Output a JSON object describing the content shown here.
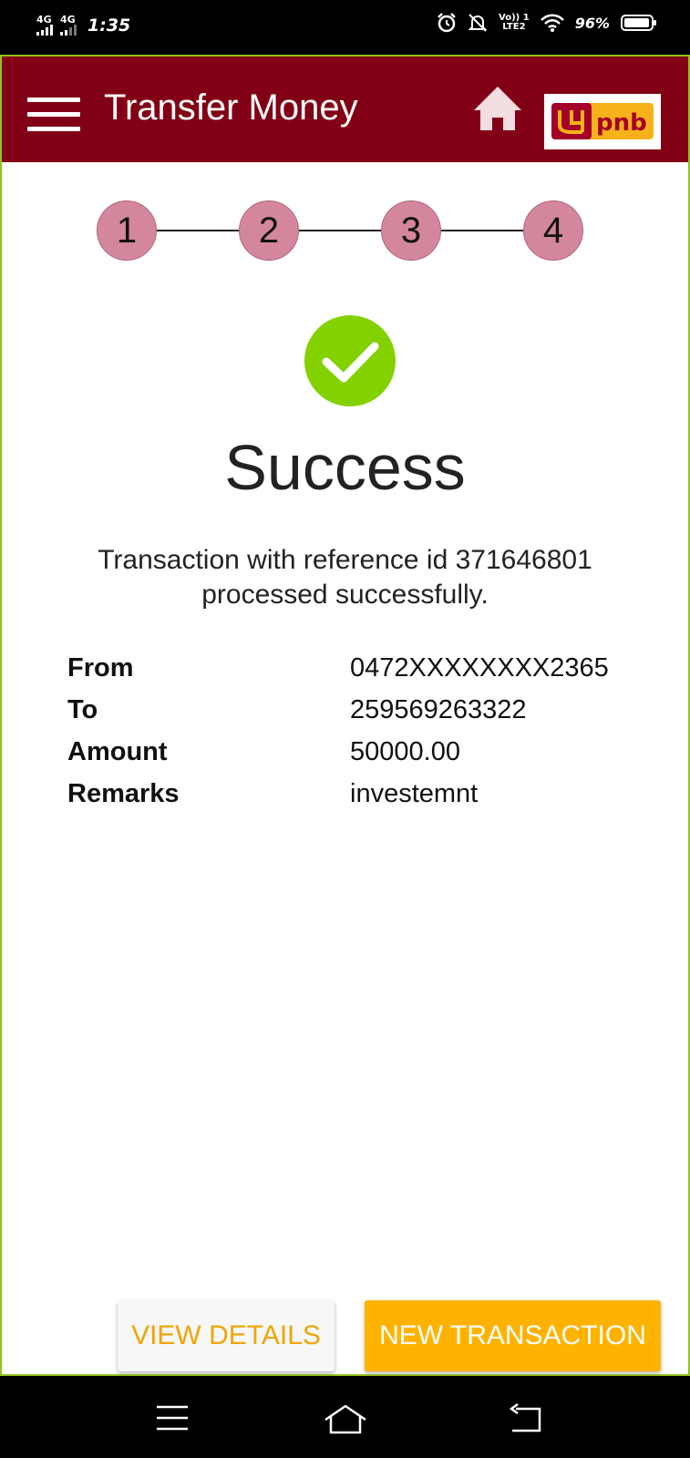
{
  "status_bar": {
    "sim1_label": "4G",
    "sim2_label": "4G",
    "time": "1:35",
    "volte_line1": "Vo)) 1",
    "volte_line2": "LTE2",
    "battery_percent": "96%",
    "battery_level": 0.96,
    "icons": [
      "alarm-icon",
      "do-not-disturb-icon",
      "wifi-icon",
      "battery-icon"
    ]
  },
  "header": {
    "title": "Transfer Money",
    "home_icon": "home-icon",
    "logo_text": "pnb",
    "colors": {
      "bar": "#820015",
      "logo_red": "#a5002a",
      "logo_yellow": "#f7b21b"
    }
  },
  "steps": [
    "1",
    "2",
    "3",
    "4"
  ],
  "result": {
    "status": "Success",
    "message_line1": "Transaction with reference id 371646801",
    "message_line2": "processed successfully.",
    "icon": "check-circle-icon",
    "accent": "#84d100"
  },
  "details": [
    {
      "label": "From",
      "value": "0472XXXXXXXX2365"
    },
    {
      "label": "To",
      "value": "259569263322"
    },
    {
      "label": "Amount",
      "value": "50000.00"
    },
    {
      "label": "Remarks",
      "value": "investemnt"
    }
  ],
  "buttons": {
    "view_details": "VIEW DETAILS",
    "new_transaction": "NEW TRANSACTION",
    "accent": "#ffb300"
  },
  "nav_bar": {
    "icons": [
      "menu-icon",
      "home-icon",
      "back-icon"
    ]
  }
}
